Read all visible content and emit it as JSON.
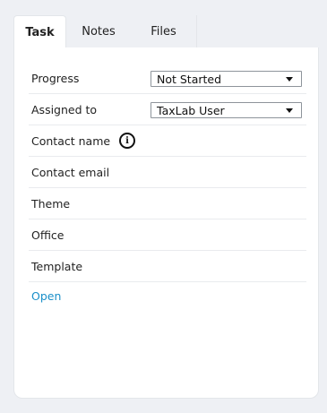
{
  "tabs": [
    {
      "label": "Task",
      "active": true
    },
    {
      "label": "Notes",
      "active": false
    },
    {
      "label": "Files",
      "active": false
    }
  ],
  "fields": {
    "progress": {
      "label": "Progress",
      "value": "Not Started"
    },
    "assigned_to": {
      "label": "Assigned to",
      "value": "TaxLab User"
    },
    "contact_name": {
      "label": "Contact name",
      "icon": "info-icon"
    },
    "contact_email": {
      "label": "Contact email"
    },
    "theme": {
      "label": "Theme"
    },
    "office": {
      "label": "Office"
    },
    "template": {
      "label": "Template"
    }
  },
  "open_link": {
    "label": "Open"
  },
  "colors": {
    "background": "#eef0f4",
    "panel": "#ffffff",
    "link": "#1a8fc9",
    "divider": "#e9ebee"
  }
}
